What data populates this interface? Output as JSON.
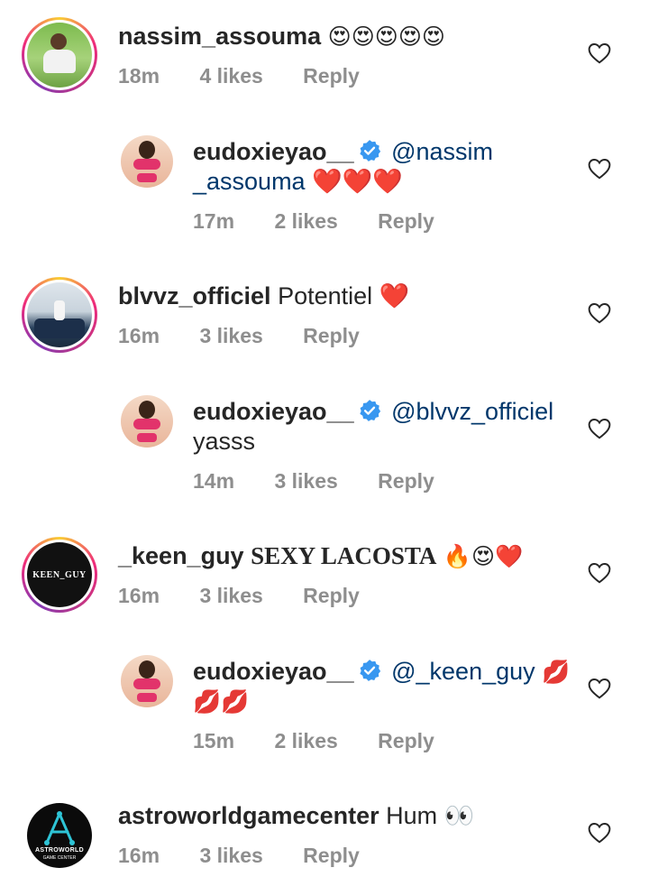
{
  "comments": [
    {
      "user": "nassim_assouma",
      "text": "😍😍😍😍😍",
      "time": "18m",
      "likes": "4 likes",
      "reply": "Reply"
    },
    {
      "user": "eudoxieyao__",
      "mention": "@nassim",
      "line2": "_assouma ❤️❤️❤️",
      "time": "17m",
      "likes": "2 likes",
      "reply": "Reply"
    },
    {
      "user": "blvvz_officiel",
      "text": "Potentiel ❤️",
      "time": "16m",
      "likes": "3 likes",
      "reply": "Reply"
    },
    {
      "user": "eudoxieyao__",
      "mention": "@blvvz_officiel",
      "line2": "yasss",
      "time": "14m",
      "likes": "3 likes",
      "reply": "Reply"
    },
    {
      "user": "_keen_guy",
      "text": "SEXY LACOSTA",
      "emoji": "🔥😍❤️",
      "avatar_text": "KEEN_GUY",
      "time": "16m",
      "likes": "3 likes",
      "reply": "Reply"
    },
    {
      "user": "eudoxieyao__",
      "mention": "@_keen_guy",
      "mention_emoji": "💋",
      "line2": "💋💋",
      "time": "15m",
      "likes": "2 likes",
      "reply": "Reply"
    },
    {
      "user": "astroworldgamecenter",
      "text": "Hum 👀",
      "avatar_text_1": "ASTROWORLD",
      "avatar_text_2": "GAME CENTER",
      "time": "16m",
      "likes": "3 likes",
      "reply": "Reply"
    }
  ],
  "colors": {
    "text": "#262626",
    "meta": "#8e8e8e",
    "mention": "#00376b",
    "verified": "#3897f0"
  },
  "icons": {
    "like": "heart-outline-icon",
    "verified": "verified-badge-icon"
  }
}
